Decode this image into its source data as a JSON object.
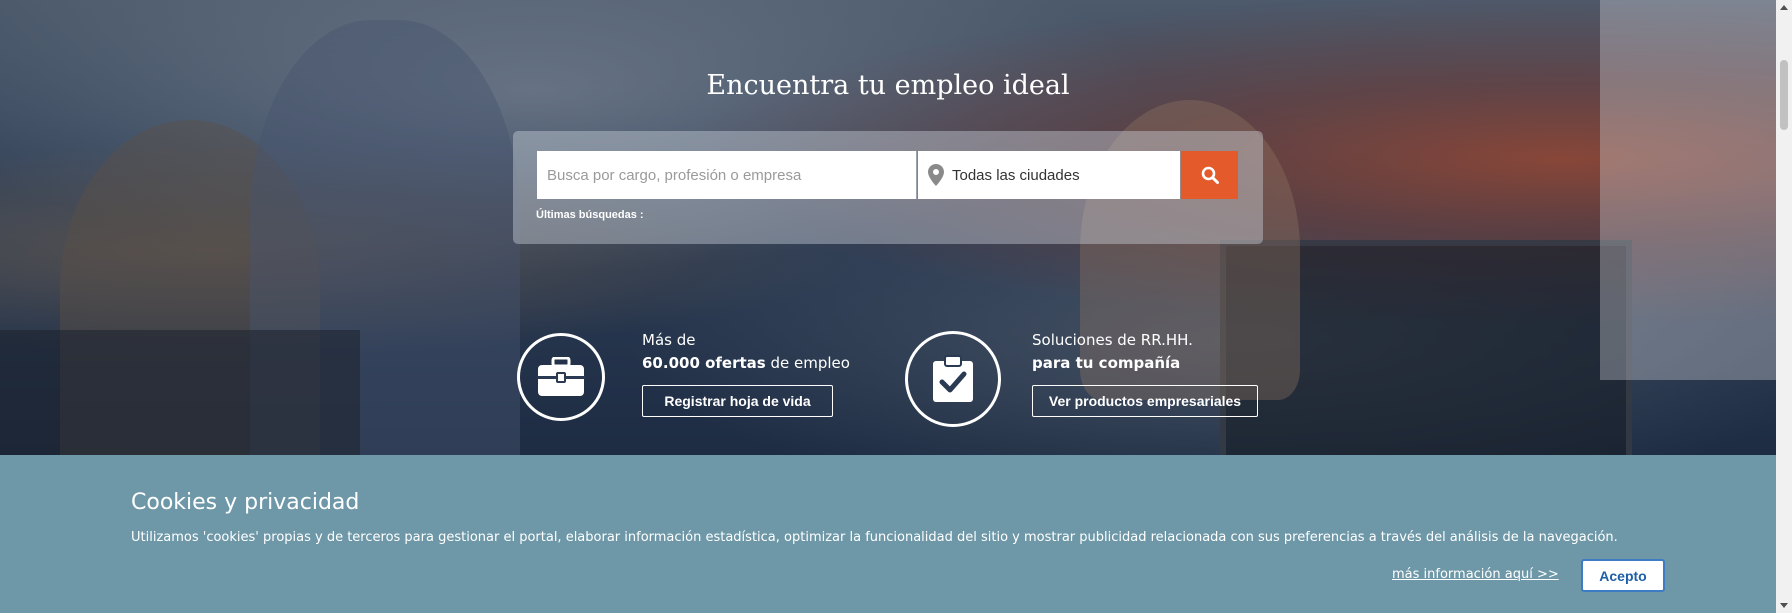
{
  "hero": {
    "title": "Encuentra tu empleo ideal"
  },
  "search": {
    "placeholder": "Busca por cargo, profesión o empresa",
    "city": "Todas las ciudades",
    "recent_label": "Últimas búsquedas :"
  },
  "promo_candidates": {
    "line1": "Más de",
    "bold": "60.000 ofertas",
    "rest": " de empleo",
    "button": "Registrar hoja de vida"
  },
  "promo_companies": {
    "line1": "Soluciones de RR.HH.",
    "bold": "para tu compañía",
    "button": "Ver productos empresariales"
  },
  "cookies": {
    "title": "Cookies y privacidad",
    "text": "Utilizamos 'cookies' propias y de terceros para gestionar el portal, elaborar información estadística, optimizar la funcionalidad del sitio y mostrar publicidad relacionada con sus preferencias a través del análisis de la navegación.",
    "link": "más información aquí >>",
    "accept": "Acepto"
  },
  "colors": {
    "accent": "#e45a2b",
    "cookie_bg": "#6e98a8",
    "accept_text": "#1e5fa8"
  },
  "icons": {
    "search": "search-icon",
    "pin": "map-pin-icon",
    "briefcase": "briefcase-icon",
    "clipboard": "clipboard-check-icon"
  }
}
